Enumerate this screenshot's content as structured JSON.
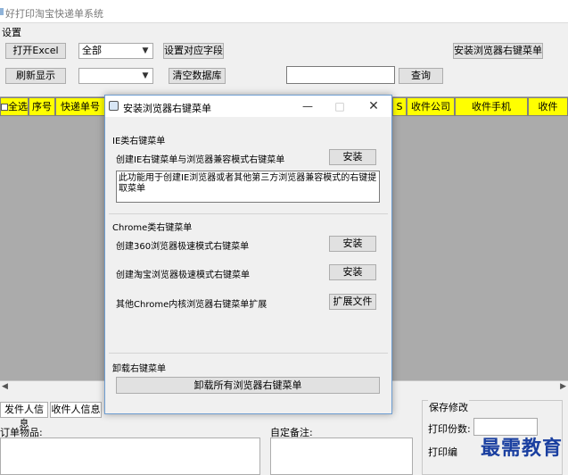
{
  "app": {
    "title": "好打印淘宝快递单系统"
  },
  "settings": {
    "group_label": "设置",
    "open_excel": "打开Excel",
    "combo_all": "全部",
    "set_fields": "设置对应字段",
    "install_browser_menu": "安装浏览器右键菜单",
    "refresh": "刷新显示",
    "combo_empty": "",
    "clear_db": "清空数据库",
    "search_value": "",
    "query": "查询"
  },
  "grid": {
    "columns": [
      "全选",
      "序号",
      "快递单号",
      "",
      "",
      "",
      "",
      "",
      "",
      "S",
      "收件公司",
      "收件手机",
      "收件"
    ]
  },
  "bottom": {
    "tab_sender": "发件人信息",
    "tab_recipient": "收件人信息",
    "order_items": "订单物品:",
    "custom_note": "自定备注:",
    "save_changes": "保存修改",
    "print_copies": "打印份数:",
    "print_number": "打印编"
  },
  "dialog": {
    "title": "安装浏览器右键菜单",
    "ie_section": "IE类右键菜单",
    "ie_row": "创建IE右键菜单与浏览器兼容模式右键菜单",
    "install": "安装",
    "ie_desc": "此功能用于创建IE浏览器或者其他第三方浏览器兼容模式的右键提取菜单",
    "chrome_section": "Chrome类右键菜单",
    "row_360": "创建360浏览器极速模式右键菜单",
    "row_taobao": "创建淘宝浏览器极速模式右键菜单",
    "row_other": "其他Chrome内核浏览器右键菜单扩展",
    "extension_file": "扩展文件",
    "uninstall_section": "卸载右键菜单",
    "uninstall_all": "卸载所有浏览器右键菜单"
  },
  "watermark": "最需教育"
}
